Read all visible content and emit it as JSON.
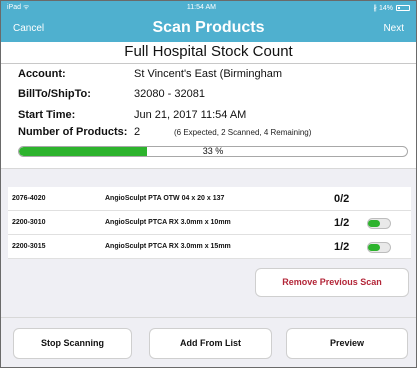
{
  "status_bar": {
    "carrier": "iPad ᯤ",
    "time": "11:54 AM",
    "battery": "∦ 14%"
  },
  "nav": {
    "cancel_label": "Cancel",
    "title": "Scan Products",
    "next_label": "Next"
  },
  "count": {
    "title": "Full Hospital Stock Count",
    "account_label": "Account:",
    "account_value": "St Vincent's East (Birmingham",
    "billto_label": "BillTo/ShipTo:",
    "billto_value": "32080 - 32081",
    "start_label": "Start Time:",
    "start_value": "Jun 21, 2017 11:54 AM",
    "num_label": "Number of Products:",
    "num_value": "2",
    "num_note": "(6 Expected, 2 Scanned, 4 Remaining)",
    "progress_text": "33 %",
    "progress_fraction": 0.33
  },
  "products": [
    {
      "code": "2076-4020",
      "description": "AngioSculpt PTA OTW 04 x 20 x 137",
      "qty": "0/2",
      "toggle": false
    },
    {
      "code": "2200-3010",
      "description": "AngioSculpt PTCA RX 3.0mm x 10mm",
      "qty": "1/2",
      "toggle": true
    },
    {
      "code": "2200-3015",
      "description": "AngioSculpt PTCA RX 3.0mm x 15mm",
      "qty": "1/2",
      "toggle": true
    }
  ],
  "actions": {
    "remove_label": "Remove Previous Scan",
    "stop_label": "Stop Scanning",
    "add_label": "Add From List",
    "preview_label": "Preview"
  },
  "colors": {
    "header": "#4fb0cf",
    "progress": "#2db32d",
    "remove_text": "#b32638"
  }
}
